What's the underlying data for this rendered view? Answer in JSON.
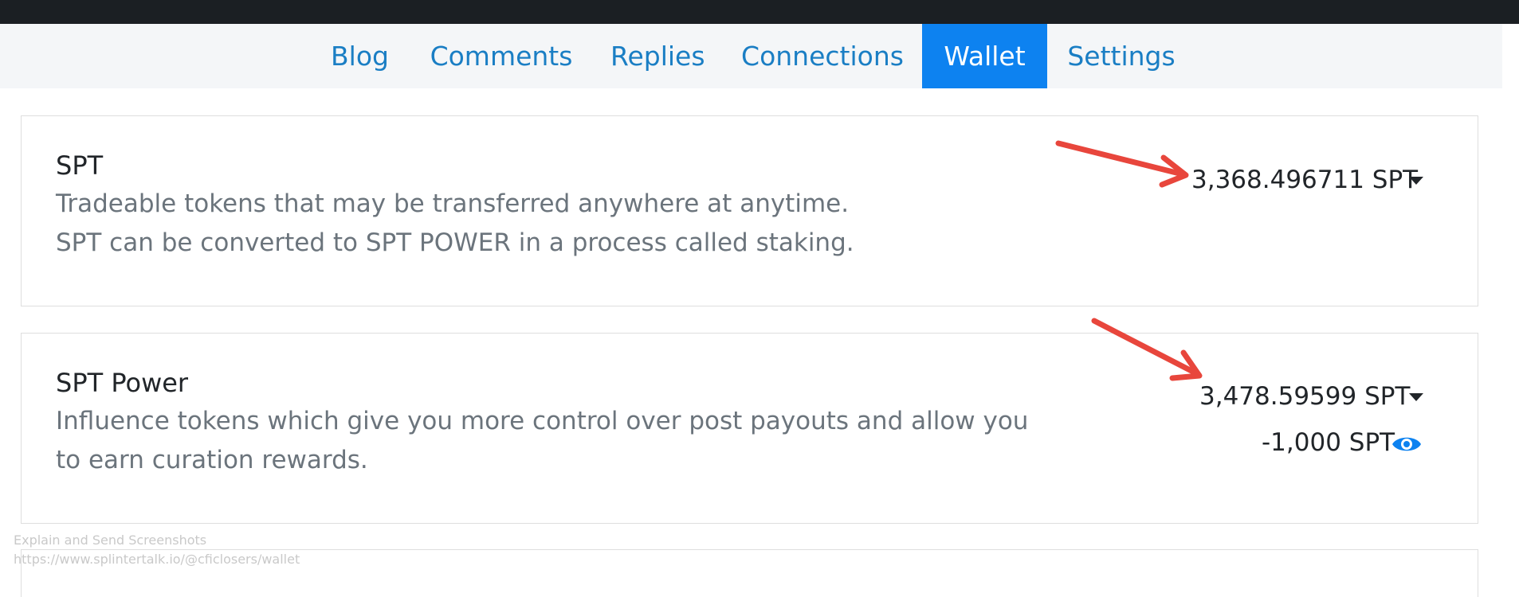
{
  "nav": {
    "tabs": [
      {
        "label": "Blog",
        "active": false
      },
      {
        "label": "Comments",
        "active": false
      },
      {
        "label": "Replies",
        "active": false
      },
      {
        "label": "Connections",
        "active": false
      },
      {
        "label": "Wallet",
        "active": true
      },
      {
        "label": "Settings",
        "active": false
      }
    ]
  },
  "spt": {
    "title": "SPT",
    "description_lines": [
      "Tradeable tokens that may be transferred anywhere at anytime.",
      "SPT can be converted to SPT POWER in a process called staking."
    ],
    "balance": "3,368.496711 SPT"
  },
  "spt_power": {
    "title": "SPT Power",
    "description_lines": [
      "Influence tokens which give you more control over post payouts and allow you",
      "to earn curation rewards."
    ],
    "balance": "3,478.59599 SPT",
    "delegated": "-1,000 SPT"
  },
  "overlay": {
    "caption": "Explain and Send Screenshots",
    "url": "https://www.splintertalk.io/@cficlosers/wallet"
  },
  "colors": {
    "accent": "#0d82f0",
    "link": "#1a7ec4",
    "annotation_arrow": "#e8463c",
    "topbar": "#1b1f23"
  },
  "icons": {
    "dropdown": "caret-down-icon",
    "view": "eye-icon",
    "annotation": "red-arrow-annotation"
  }
}
